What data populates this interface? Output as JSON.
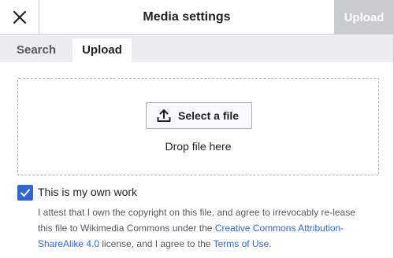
{
  "header": {
    "close_icon": "close-icon",
    "title": "Media settings",
    "upload_button": "Upload"
  },
  "tabs": [
    {
      "label": "Search",
      "active": false
    },
    {
      "label": "Upload",
      "active": true
    }
  ],
  "dropzone": {
    "select_button": "Select a file",
    "select_icon": "upload-icon",
    "drop_text": "Drop file here"
  },
  "own_work": {
    "checked": true,
    "label": "This is my own work",
    "attest_text_1": "I attest that I own the copyright on this file, and agree to irrevocably re-lease this file to Wikimedia Commons under the ",
    "license_link": "Creative Commons Attribution-ShareAlike 4.0",
    "attest_text_2": " license, and I agree to the ",
    "terms_link": "Terms of Use",
    "attest_text_3": "."
  },
  "colors": {
    "accent": "#3366cc",
    "disabled_button": "#c8ccd1",
    "tab_bar": "#eaecf0"
  }
}
